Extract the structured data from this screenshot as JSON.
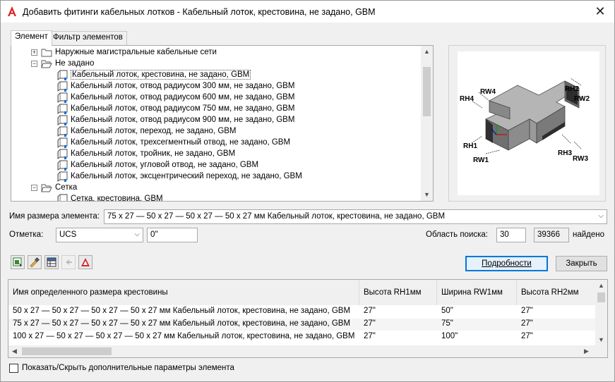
{
  "window": {
    "title": "Добавить фитинги кабельных лотков - Кабельный лоток, крестовина, не задано, GBM",
    "app_icon": "autocad-a-icon",
    "close_glyph": "✕"
  },
  "tabs": [
    {
      "label": "Элемент",
      "active": true
    },
    {
      "label": "Фильтр элементов",
      "active": false
    }
  ],
  "tree": {
    "rows": [
      {
        "level": 1,
        "type": "folder",
        "expander": "+",
        "label": "Наружные магистральные кабельные сети"
      },
      {
        "level": 1,
        "type": "folder-open",
        "expander": "-",
        "label": "Не задано"
      },
      {
        "level": 2,
        "type": "item",
        "label": "Кабельный лоток, крестовина, не задано, GBM",
        "selected": true
      },
      {
        "level": 2,
        "type": "item",
        "label": "Кабельный лоток, отвод радиусом 300 мм, не задано, GBM"
      },
      {
        "level": 2,
        "type": "item",
        "label": "Кабельный лоток, отвод радиусом 600 мм, не задано, GBM"
      },
      {
        "level": 2,
        "type": "item",
        "label": "Кабельный лоток, отвод радиусом 750 мм, не задано, GBM"
      },
      {
        "level": 2,
        "type": "item",
        "label": "Кабельный лоток, отвод радиусом 900 мм, не задано, GBM"
      },
      {
        "level": 2,
        "type": "item",
        "label": "Кабельный лоток, переход, не задано, GBM"
      },
      {
        "level": 2,
        "type": "item",
        "label": "Кабельный лоток, трехсегментный отвод, не задано, GBM"
      },
      {
        "level": 2,
        "type": "item",
        "label": "Кабельный лоток, тройник, не задано, GBM"
      },
      {
        "level": 2,
        "type": "item",
        "label": "Кабельный лоток, угловой отвод, не задано, GBM"
      },
      {
        "level": 2,
        "type": "item",
        "label": "Кабельный лоток, эксцентрический переход, не задано, GBM"
      },
      {
        "level": 1,
        "type": "folder-open",
        "expander": "-",
        "label": "Сетка"
      },
      {
        "level": 2,
        "type": "item",
        "label": "Сетка, крестовина, GBM"
      }
    ]
  },
  "preview": {
    "labels": {
      "rw4": "RW4",
      "rh4": "RH4",
      "rh2": "RH2",
      "rw2": "RW2",
      "rh1": "RH1",
      "rw1": "RW1",
      "rh3": "RH3",
      "rw3": "RW3"
    }
  },
  "size_name": {
    "label": "Имя размера элемента:",
    "value": "75 x 27 — 50 x 27 — 50 x 27 — 50 x 27 мм Кабельный лоток, крестовина, не задано, GBM"
  },
  "elevation": {
    "label": "Отметка:",
    "ucs_value": "UCS",
    "value": "0\""
  },
  "search": {
    "label": "Область поиска:",
    "radius": "30",
    "count": "39366",
    "found_label": "найдено"
  },
  "toolbar": {
    "icons": [
      "add-to-drawing-icon",
      "brush-icon",
      "table-view-icon",
      "arrow-left-icon",
      "revit-icon"
    ]
  },
  "buttons": {
    "details": "Подробности",
    "close": "Закрыть"
  },
  "grid": {
    "columns": [
      "Имя определенного размера крестовины",
      "Высота RH1мм",
      "Ширина RW1мм",
      "Высота RH2мм"
    ],
    "rows": [
      [
        "50 x 27 — 50 x 27 — 50 x 27 — 50 x 27 мм Кабельный лоток, крестовина, не задано, GBM",
        "27\"",
        "50\"",
        "27\""
      ],
      [
        "75 x 27 — 50 x 27 — 50 x 27 — 50 x 27 мм Кабельный лоток, крестовина, не задано, GBM",
        "27\"",
        "75\"",
        "27\""
      ],
      [
        "100 x 27 — 50 x 27 — 50 x 27 — 50 x 27 мм Кабельный лоток, крестовина, не задано, GBM",
        "27\"",
        "100\"",
        "27\""
      ]
    ]
  },
  "footer": {
    "show_hide_label": "Показать/Скрыть дополнительные параметры элемента"
  }
}
